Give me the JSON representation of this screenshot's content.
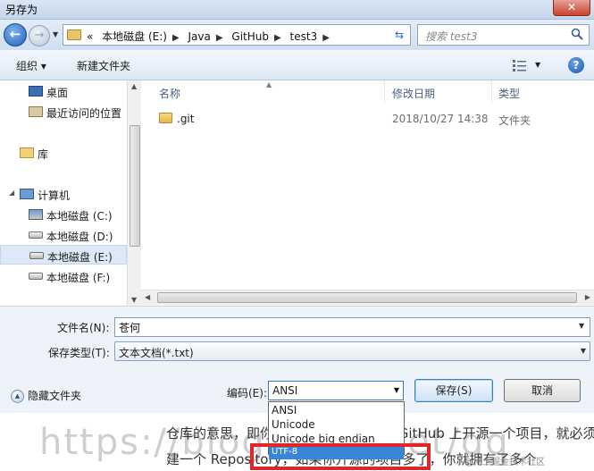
{
  "window": {
    "title": "另存为",
    "close_label": "✕"
  },
  "nav": {
    "breadcrumbs": [
      "«",
      "本地磁盘 (E:)",
      "Java",
      "GitHub",
      "test3"
    ],
    "search_placeholder": "搜索 test3"
  },
  "toolbar": {
    "organize_label": "组织 ▾",
    "new_folder_label": "新建文件夹"
  },
  "sidebar": {
    "items": [
      {
        "label": "桌面"
      },
      {
        "label": "最近访问的位置"
      },
      {
        "label": "库"
      },
      {
        "label": "计算机"
      },
      {
        "label": "本地磁盘 (C:)"
      },
      {
        "label": "本地磁盘 (D:)"
      },
      {
        "label": "本地磁盘 (E:)",
        "selected": true
      },
      {
        "label": "本地磁盘 (F:)"
      }
    ]
  },
  "filelist": {
    "columns": [
      "名称",
      "修改日期",
      "类型"
    ],
    "rows": [
      {
        "name": ".git",
        "date": "2018/10/27 14:38",
        "type": "文件夹"
      }
    ]
  },
  "form": {
    "filename_label": "文件名(N):",
    "filename_value": "苍何",
    "savetype_label": "保存类型(T):",
    "savetype_value": "文本文档(*.txt)"
  },
  "bottom": {
    "hide_folders_label": "隐藏文件夹",
    "encoding_label": "编码(E):",
    "encoding_value": "ANSI",
    "save_label": "保存(S)",
    "cancel_label": "取消"
  },
  "encoding_options": [
    "ANSI",
    "Unicode",
    "Unicode big endian",
    "UTF-8"
  ],
  "background_text": {
    "line1": "仓库的意思，即你的一个项目，你想在 GitHub 上开源一个项目，就必须要新",
    "line2": "建一个 Repository，如果你开源的项目多了，你就拥有了多个",
    "watermark": "https://blog.csdn.net/qq",
    "credit": "@稀土掘金技术社区"
  },
  "colors": {
    "accent": "#3b85d8",
    "highlight_box": "#e0262b"
  }
}
